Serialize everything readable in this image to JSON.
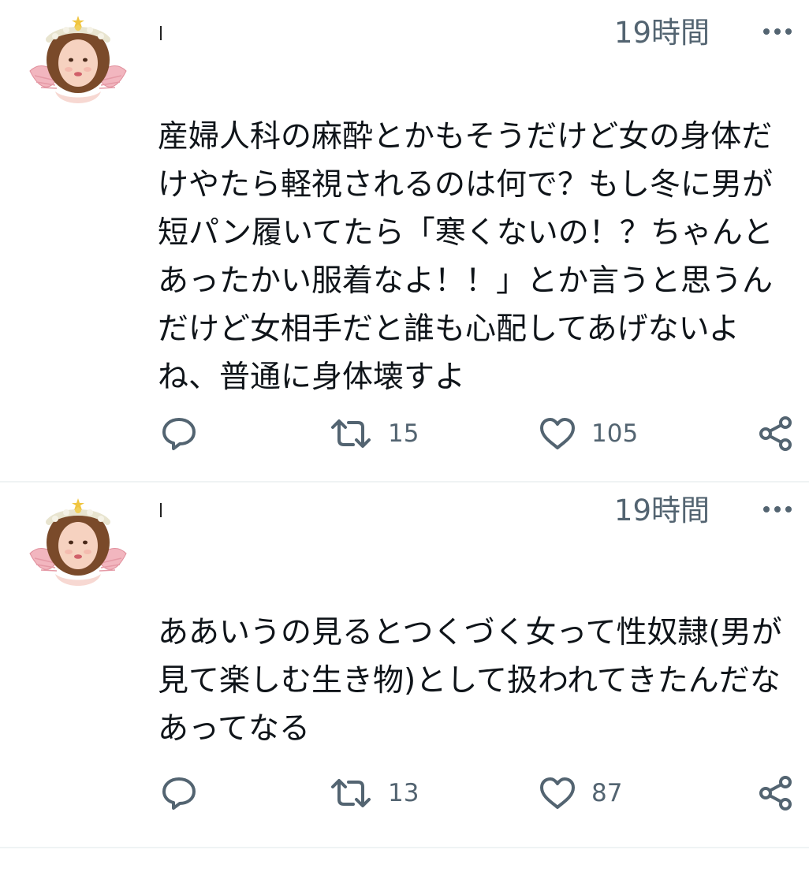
{
  "tweets": [
    {
      "time": "19時間",
      "text": "産婦人科の麻酔とかもそうだけど女の身体だけやたら軽視されるのは何で？もし冬に男が短パン履いてたら「寒くないの！？ちゃんとあったかい服着なよ！！」とか言うと思うんだけど女相手だと誰も心配してあげないよね、普通に身体壊すよ",
      "retweets": "15",
      "likes": "105"
    },
    {
      "time": "19時間",
      "text": "ああいうの見るとつくづく女って性奴隷(男が見て楽しむ生き物)として扱われてきたんだなあってなる",
      "retweets": "13",
      "likes": "87"
    }
  ],
  "icons": {
    "avatar": "angel-avatar-icon",
    "more": "more-dots-icon",
    "reply": "reply-icon",
    "retweet": "retweet-icon",
    "like": "heart-icon",
    "share": "share-icon"
  },
  "colors": {
    "text": "#0f1419",
    "secondary": "#536471",
    "divider": "#eff3f4"
  }
}
